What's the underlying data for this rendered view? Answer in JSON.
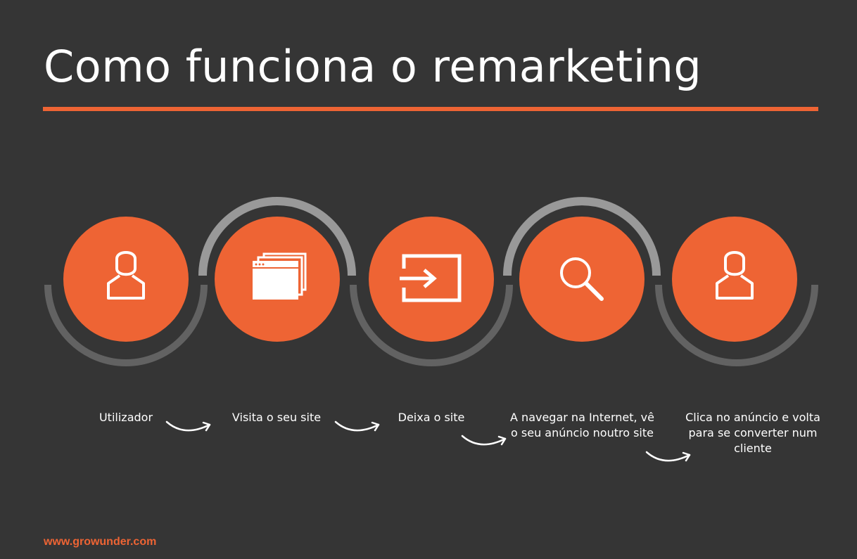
{
  "title": "Como funciona o remarketing",
  "colors": {
    "background": "#353535",
    "accent": "#ee6434",
    "ring_dark": "#626262",
    "ring_light": "#999999",
    "text": "#ffffff"
  },
  "steps": [
    {
      "label": "Utilizador",
      "icon": "user-icon"
    },
    {
      "label": "Visita o seu site",
      "icon": "browser-windows-icon"
    },
    {
      "label": "Deixa o site",
      "icon": "exit-arrow-icon"
    },
    {
      "label": "A navegar na Internet, vê o seu anúncio noutro site",
      "icon": "search-icon"
    },
    {
      "label": "Clica no anúncio e volta para se converter num cliente",
      "icon": "user-icon"
    }
  ],
  "footer": "www.growunder.com"
}
